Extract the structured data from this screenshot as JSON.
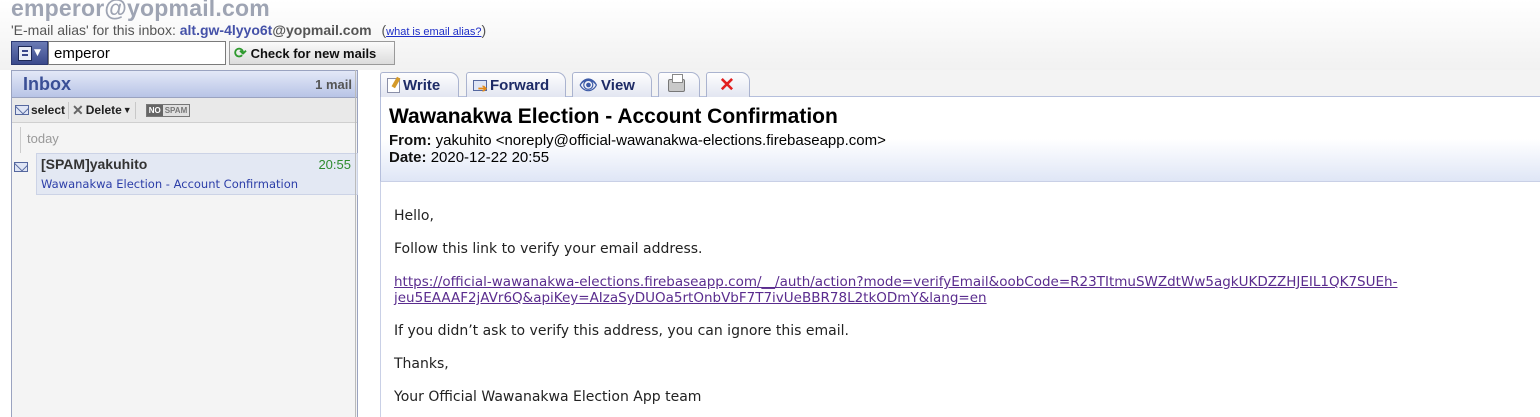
{
  "header": {
    "email_address": "emperor@yopmail.com",
    "alias_prefix": "'E-mail alias' for this inbox: ",
    "alias_local": "alt.gw-4lyyo6t",
    "alias_domain": "@yopmail.com",
    "alias_help_link": "what is email alias?",
    "login_value": "emperor",
    "check_button": "Check for new mails"
  },
  "inbox": {
    "title": "Inbox",
    "count": "1 mail",
    "toolbar": {
      "select": "select",
      "delete": "Delete",
      "nospam_no": "NO",
      "nospam_spam": "SPAM"
    },
    "group_label": "today",
    "mails": [
      {
        "from": "[SPAM]yakuhito",
        "time": "20:55",
        "subject": "Wawanakwa Election - Account Confirmation"
      }
    ]
  },
  "viewer": {
    "tabs": {
      "write": "Write",
      "forward": "Forward",
      "view": "View"
    },
    "subject": "Wawanakwa Election - Account Confirmation",
    "from_label": "From:",
    "from_value": "yakuhito <noreply@official-wawanakwa-elections.firebaseapp.com>",
    "date_label": "Date:",
    "date_value": "2020-12-22 20:55",
    "body": {
      "greeting": "Hello,",
      "instruction": "Follow this link to verify your email address.",
      "link_line1": "https://official-wawanakwa-elections.firebaseapp.com/__/auth/action?mode=verifyEmail&oobCode=R23TItmuSWZdtWw5agkUKDZZHJEIL1QK7SUEh-",
      "link_line2": "jeu5EAAAF2jAVr6Q&apiKey=AIzaSyDUOa5rtOnbVbF7T7ivUeBBR78L2tkODmY&lang=en",
      "ignore_note": "If you didn’t ask to verify this address, you can ignore this email.",
      "thanks": "Thanks,",
      "signature": "Your Official Wawanakwa Election App team"
    }
  },
  "colors": {
    "accent_blue": "#3a4f96",
    "link_blue": "#2c3ea8",
    "visited_link": "#5a2c8e",
    "time_green": "#2e8b2e",
    "delete_red": "#e21f1f"
  }
}
